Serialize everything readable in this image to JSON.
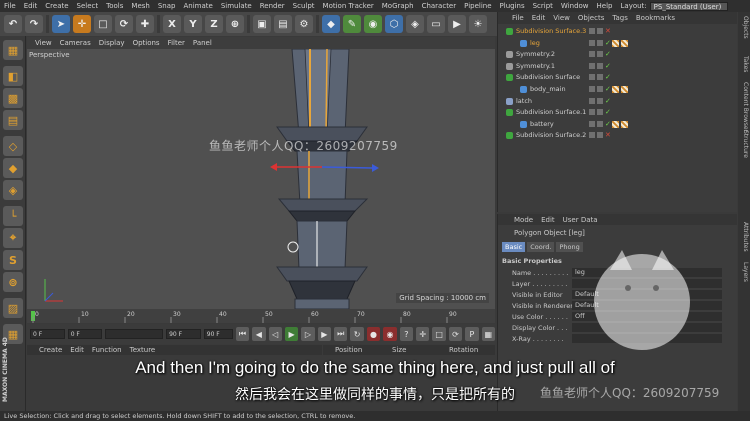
{
  "menu": [
    "File",
    "Edit",
    "Create",
    "Select",
    "Tools",
    "Mesh",
    "Snap",
    "Animate",
    "Simulate",
    "Render",
    "Sculpt",
    "Motion Tracker",
    "MoGraph",
    "Character",
    "Pipeline",
    "Plugins",
    "Script",
    "Window",
    "Help"
  ],
  "layout": {
    "label": "Layout:",
    "value": "PS_Standard (User)"
  },
  "toolbar": {
    "x_label": "X",
    "y_label": "Y",
    "z_label": "Z"
  },
  "viewport": {
    "menu": [
      "View",
      "Cameras",
      "Display",
      "Options",
      "Filter",
      "Panel"
    ],
    "camera_label": "Perspective",
    "grid_spacing": "Grid Spacing : 10000 cm",
    "watermark": "鱼鱼老师个人QQ：2609207759"
  },
  "timeline": {
    "ticks": [
      "0",
      "10",
      "20",
      "30",
      "40",
      "50",
      "60",
      "70",
      "80",
      "90"
    ],
    "start_field": "0 F",
    "current_field": "0 F",
    "end_field": "90 F",
    "max_field": "90 F"
  },
  "materials": {
    "menu": [
      "Create",
      "Edit",
      "Function",
      "Texture"
    ]
  },
  "coordinates": {
    "headers": [
      "Position",
      "Size",
      "Rotation"
    ]
  },
  "objects": {
    "menu": [
      "File",
      "Edit",
      "View",
      "Objects",
      "Tags",
      "Bookmarks"
    ],
    "items": [
      {
        "name": "Subdivision Surface.3",
        "indent": 0,
        "type": "subdiv",
        "selected": true
      },
      {
        "name": "leg",
        "indent": 1,
        "type": "poly",
        "selected": true
      },
      {
        "name": "Symmetry.2",
        "indent": 0,
        "type": "sym",
        "selected": false
      },
      {
        "name": "Symmetry.1",
        "indent": 0,
        "type": "sym",
        "selected": false
      },
      {
        "name": "Subdivision Surface",
        "indent": 0,
        "type": "subdiv",
        "selected": false
      },
      {
        "name": "body_main",
        "indent": 1,
        "type": "poly",
        "selected": false
      },
      {
        "name": "latch",
        "indent": 0,
        "type": "null",
        "selected": false
      },
      {
        "name": "Subdivision Surface.1",
        "indent": 0,
        "type": "subdiv",
        "selected": false
      },
      {
        "name": "battery",
        "indent": 1,
        "type": "poly",
        "selected": false
      },
      {
        "name": "Subdivision Surface.2",
        "indent": 0,
        "type": "subdiv",
        "selected": false
      }
    ]
  },
  "attributes": {
    "menu": [
      "Mode",
      "Edit",
      "User Data"
    ],
    "object_title": "Polygon Object [leg]",
    "tabs": [
      "Basic",
      "Coord.",
      "Phong"
    ],
    "section": "Basic Properties",
    "props": [
      {
        "label": "Name . . . . . . . . .",
        "value": "leg"
      },
      {
        "label": "Layer . . . . . . . . .",
        "value": ""
      },
      {
        "label": "Visible in Editor",
        "value": "Default"
      },
      {
        "label": "Visible in Renderer",
        "value": "Default"
      },
      {
        "label": "Use Color . . . . . .",
        "value": "Off"
      },
      {
        "label": "Display Color . . .",
        "value": ""
      },
      {
        "label": "X-Ray . . . . . . . .",
        "value": ""
      }
    ]
  },
  "right_tabs": [
    "Objects",
    "Takes",
    "Content Browser",
    "Structure",
    "Attributes",
    "Layers"
  ],
  "status": "Live Selection: Click and drag to select elements. Hold down SHIFT to add to the selection, CTRL to remove.",
  "subtitles": {
    "en": "And then I'm going to do the same thing here, and just pull all of",
    "zh": "然后我会在这里做同样的事情，只是把所有的",
    "watermark": "鱼鱼老师个人QQ：2609207759"
  },
  "branding": {
    "maxon": "MAXON CINEMA 4D"
  },
  "colors": {
    "accent_orange": "#e8a63a",
    "selection_blue": "#6a8bc0",
    "check_green": "#6dcf4a"
  }
}
